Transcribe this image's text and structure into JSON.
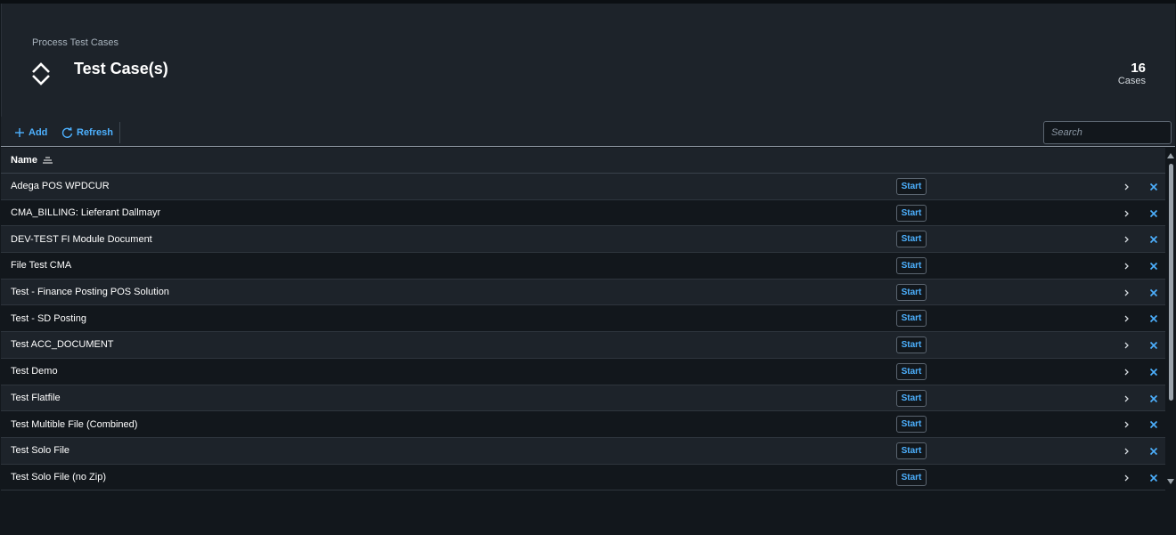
{
  "header": {
    "breadcrumb": "Process Test Cases",
    "title": "Test Case(s)",
    "kpi_value": "16",
    "kpi_label": "Cases"
  },
  "toolbar": {
    "add_label": "Add",
    "refresh_label": "Refresh",
    "search_placeholder": "Search"
  },
  "table": {
    "column_name": "Name",
    "start_label": "Start",
    "rows": [
      "Adega POS WPDCUR",
      "CMA_BILLING: Lieferant Dallmayr",
      "DEV-TEST FI Module Document",
      "File Test CMA",
      "Test - Finance Posting POS Solution",
      "Test - SD Posting",
      "Test ACC_DOCUMENT",
      "Test Demo",
      "Test Flatfile",
      "Test Multible File (Combined)",
      "Test Solo File",
      "Test Solo File (no Zip)"
    ]
  },
  "colors": {
    "accent": "#4db1ff",
    "header_bg": "#1d232a",
    "page_bg": "#12171c"
  }
}
